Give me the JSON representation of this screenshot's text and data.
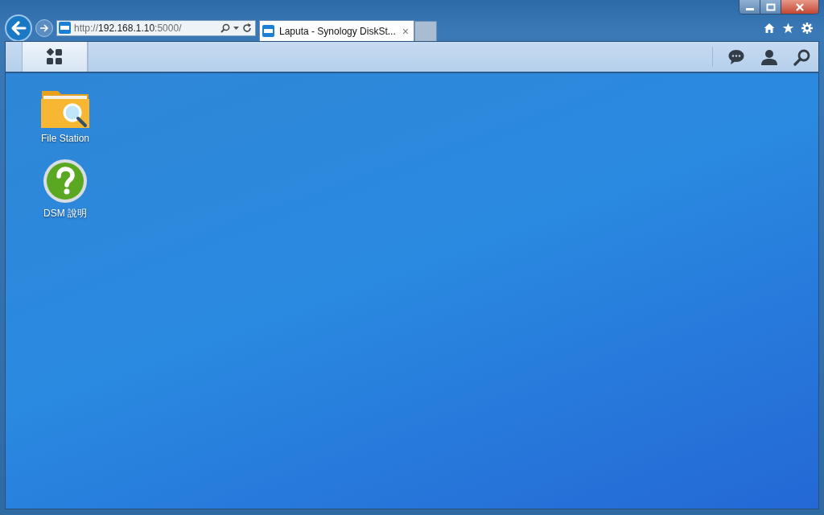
{
  "browser": {
    "address": {
      "scheme": "http://",
      "host": "192.168.1.10",
      "port": ":5000/"
    },
    "tabs": [
      {
        "title": "Laputa - Synology DiskSt...",
        "close": "×",
        "selected": true
      }
    ]
  },
  "desktop": {
    "icons": [
      {
        "kind": "folder",
        "label": "File Station"
      },
      {
        "kind": "help",
        "label": "DSM 說明"
      }
    ]
  }
}
